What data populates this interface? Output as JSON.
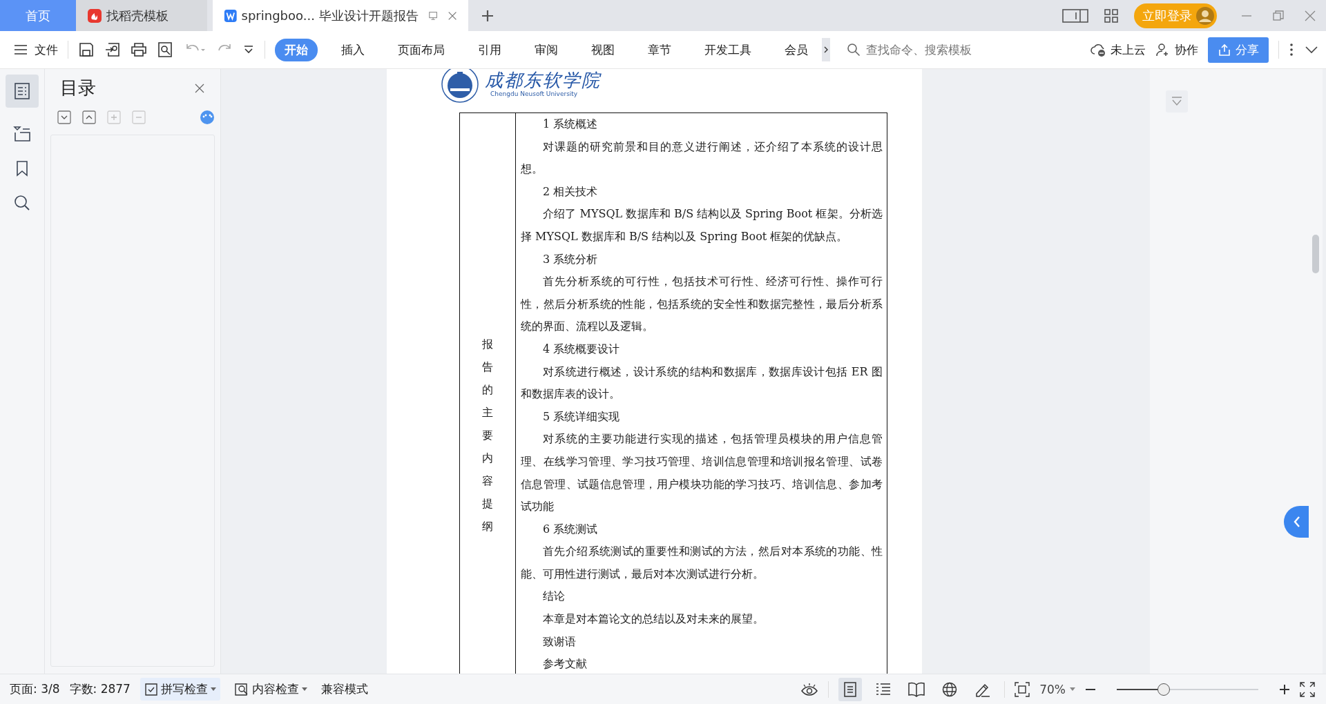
{
  "title_bar": {
    "tabs": [
      {
        "kind": "home",
        "label": "首页",
        "selected": false
      },
      {
        "kind": "docer",
        "label": "找稻壳模板",
        "selected": false
      },
      {
        "kind": "doc",
        "label": "springboo... 毕业设计开题报告",
        "selected": true
      }
    ],
    "login": "立即登录"
  },
  "toolbar": {
    "file_menu": "文件",
    "ribbon_tabs": [
      {
        "label": "开始",
        "selected": true
      },
      {
        "label": "插入",
        "selected": false
      },
      {
        "label": "页面布局",
        "selected": false
      },
      {
        "label": "引用",
        "selected": false
      },
      {
        "label": "审阅",
        "selected": false
      },
      {
        "label": "视图",
        "selected": false
      },
      {
        "label": "章节",
        "selected": false
      },
      {
        "label": "开发工具",
        "selected": false
      },
      {
        "label": "会员",
        "selected": false
      }
    ],
    "search": {
      "placeholder": "查找命令、搜索模板"
    },
    "cloud": "未上云",
    "collaborate": "协作",
    "share": "分享"
  },
  "outline_panel": {
    "title": "目录"
  },
  "document": {
    "logo": {
      "name": "成都东软学院",
      "english": "Chengdu Neusoft University"
    },
    "table": {
      "label": "报告的主要内容提纲",
      "paragraphs": [
        {
          "text": "1 系统概述"
        },
        {
          "text": "对课题的研究前景和目的意义进行阐述，还介绍了本系统的设计思想。"
        },
        {
          "text": "2 相关技术"
        },
        {
          "text": "介绍了 MYSQL 数据库和 B/S 结构以及 Spring Boot 框架。分析选择 MYSQL 数据库和 B/S 结构以及 Spring Boot 框架的优缺点。"
        },
        {
          "text": "3 系统分析"
        },
        {
          "text": "首先分析系统的可行性，包括技术可行性、经济可行性、操作可行性，然后分析系统的性能，包括系统的安全性和数据完整性，最后分析系统的界面、流程以及逻辑。"
        },
        {
          "text": "4 系统概要设计"
        },
        {
          "text": "对系统进行概述，设计系统的结构和数据库，数据库设计包括 ER 图和数据库表的设计。"
        },
        {
          "text": "5 系统详细实现"
        },
        {
          "text": "对系统的主要功能进行实现的描述，包括管理员模块的用户信息管理、在线学习管理、学习技巧管理、培训信息管理和培训报名管理、试卷信息管理、试题信息管理，用户模块功能的学习技巧、培训信息、参加考试功能"
        },
        {
          "text": "6 系统测试"
        },
        {
          "text": "首先介绍系统测试的重要性和测试的方法，然后对本系统的功能、性能、可用性进行测试，最后对本次测试进行分析。"
        },
        {
          "text": "结论"
        },
        {
          "text": "本章是对本篇论文的总结以及对未来的展望。"
        },
        {
          "text": "致谢语"
        },
        {
          "text": "参考文献"
        }
      ]
    }
  },
  "status_bar": {
    "page": "页面: 3/8",
    "word_count": "字数: 2877",
    "spell_check": "拼写检查",
    "content_check": "内容检查",
    "compat_mode": "兼容模式",
    "views": [
      {
        "kind": "page",
        "selected": true
      },
      {
        "kind": "outline",
        "selected": false
      },
      {
        "kind": "book",
        "selected": false
      },
      {
        "kind": "web",
        "selected": false
      },
      {
        "kind": "pen",
        "selected": false
      }
    ],
    "zoom": {
      "reading": "70%",
      "level": 0.33
    }
  }
}
